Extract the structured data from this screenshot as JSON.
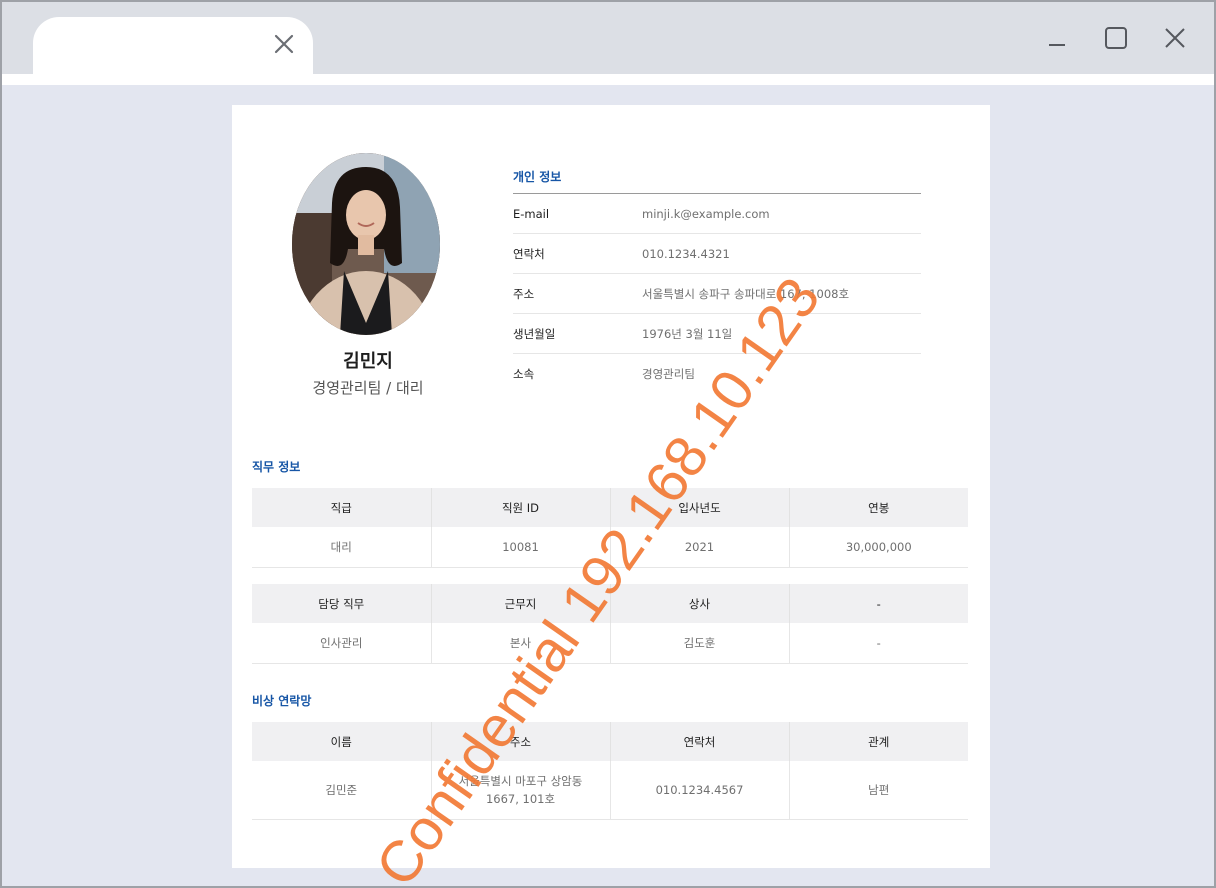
{
  "profile": {
    "name": "김민지",
    "role": "경영관리팀 / 대리"
  },
  "personal_info": {
    "title": "개인 정보",
    "rows": [
      {
        "label": "E-mail",
        "value": "minji.k@example.com"
      },
      {
        "label": "연락처",
        "value": "010.1234.4321"
      },
      {
        "label": "주소",
        "value": "서울특별시 송파구 송파대로 167, 1008호"
      },
      {
        "label": "생년월일",
        "value": "1976년 3월 11일"
      },
      {
        "label": "소속",
        "value": "경영관리팀"
      }
    ]
  },
  "job_info": {
    "title": "직무 정보",
    "table1": {
      "headers": [
        "직급",
        "직원 ID",
        "입사년도",
        "연봉"
      ],
      "values": [
        "대리",
        "10081",
        "2021",
        "30,000,000"
      ]
    },
    "table2": {
      "headers": [
        "담당 직무",
        "근무지",
        "상사",
        "-"
      ],
      "values": [
        "인사관리",
        "본사",
        "김도훈",
        "-"
      ]
    }
  },
  "emergency": {
    "title": "비상 연락망",
    "headers": [
      "이름",
      "주소",
      "연락처",
      "관계"
    ],
    "values": [
      "김민준",
      "서울특별시 마포구 상암동\n1667, 101호",
      "010.1234.4567",
      "남편"
    ]
  },
  "watermark": "Confidential 192.168.10.123",
  "colors": {
    "accent": "#1756a6",
    "watermark": "#f27a36",
    "page_bg": "#e3e6f0",
    "header_cell_bg": "#f0f0f2"
  }
}
